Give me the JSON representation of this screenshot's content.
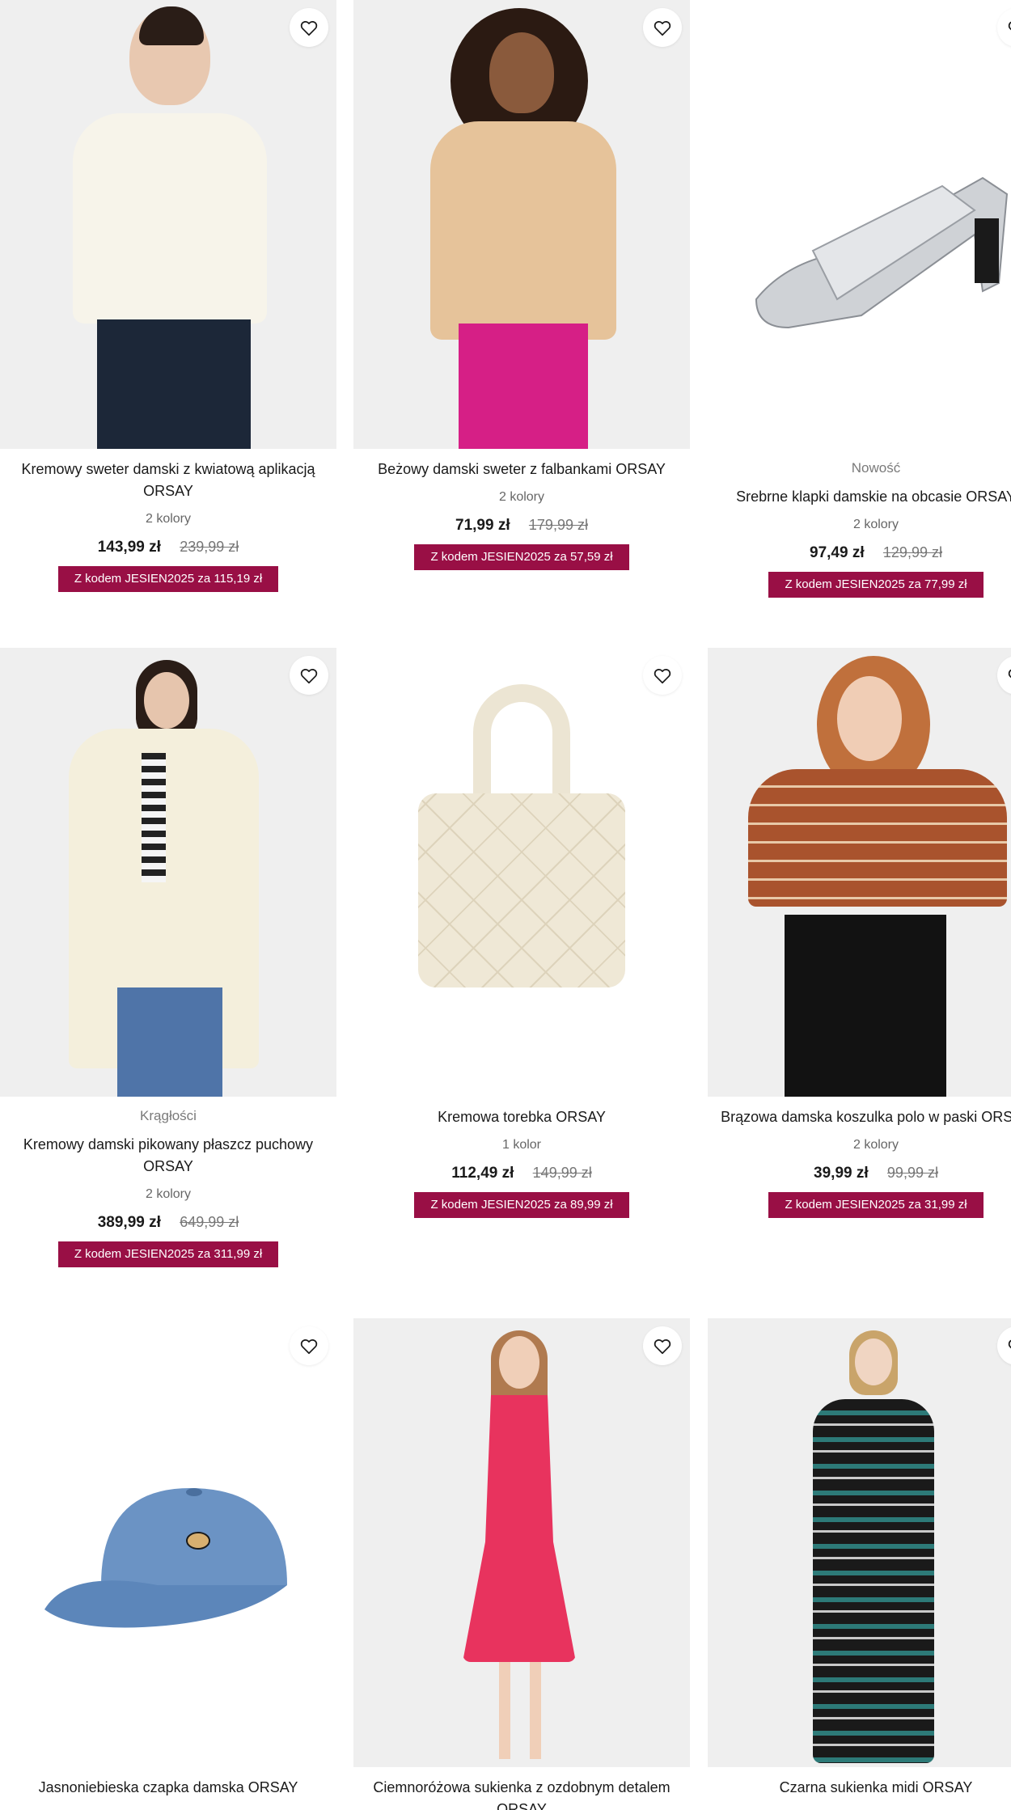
{
  "products": [
    {
      "flag": "",
      "title": "Kremowy sweter damski z kwiatową aplikacją ORSAY",
      "colors": "2 kolory",
      "price": "143,99 zł",
      "old_price": "239,99 zł",
      "promo": "Z kodem JESIEN2025 za 115,19 zł",
      "icon": "heart-outline-icon"
    },
    {
      "flag": "",
      "title": "Beżowy damski sweter z falbankami ORSAY",
      "colors": "2 kolory",
      "price": "71,99 zł",
      "old_price": "179,99 zł",
      "promo": "Z kodem JESIEN2025 za 57,59 zł",
      "icon": "heart-outline-icon"
    },
    {
      "flag": "Nowość",
      "title": "Srebrne klapki damskie na obcasie ORSAY",
      "colors": "2 kolory",
      "price": "97,49 zł",
      "old_price": "129,99 zł",
      "promo": "Z kodem JESIEN2025 za 77,99 zł",
      "icon": "heart-outline-icon"
    },
    {
      "flag": "Krągłości",
      "title": "Kremowy damski pikowany płaszcz puchowy ORSAY",
      "colors": "2 kolory",
      "price": "389,99 zł",
      "old_price": "649,99 zł",
      "promo": "Z kodem JESIEN2025 za 311,99 zł",
      "icon": "heart-outline-icon"
    },
    {
      "flag": "",
      "title": "Kremowa torebka ORSAY",
      "colors": "1 kolor",
      "price": "112,49 zł",
      "old_price": "149,99 zł",
      "promo": "Z kodem JESIEN2025 za 89,99 zł",
      "icon": "heart-outline-icon"
    },
    {
      "flag": "",
      "title": "Brązowa damska koszulka polo w paski ORSAY",
      "colors": "2 kolory",
      "price": "39,99 zł",
      "old_price": "99,99 zł",
      "promo": "Z kodem JESIEN2025 za 31,99 zł",
      "icon": "heart-outline-icon"
    },
    {
      "flag": "",
      "title": "Jasnoniebieska czapka damska ORSAY",
      "colors": "",
      "price": "",
      "old_price": "",
      "promo": "",
      "icon": "heart-outline-icon"
    },
    {
      "flag": "",
      "title": "Ciemnoróżowa sukienka z ozdobnym detalem ORSAY",
      "colors": "",
      "price": "",
      "old_price": "",
      "promo": "",
      "icon": "heart-outline-icon"
    },
    {
      "flag": "",
      "title": "Czarna sukienka midi ORSAY",
      "colors": "",
      "price": "",
      "old_price": "",
      "promo": "",
      "icon": "heart-outline-icon"
    }
  ],
  "colors": {
    "promo_bg": "#990f45",
    "promo_text": "#ffffff",
    "card_bg": "#efefef"
  }
}
